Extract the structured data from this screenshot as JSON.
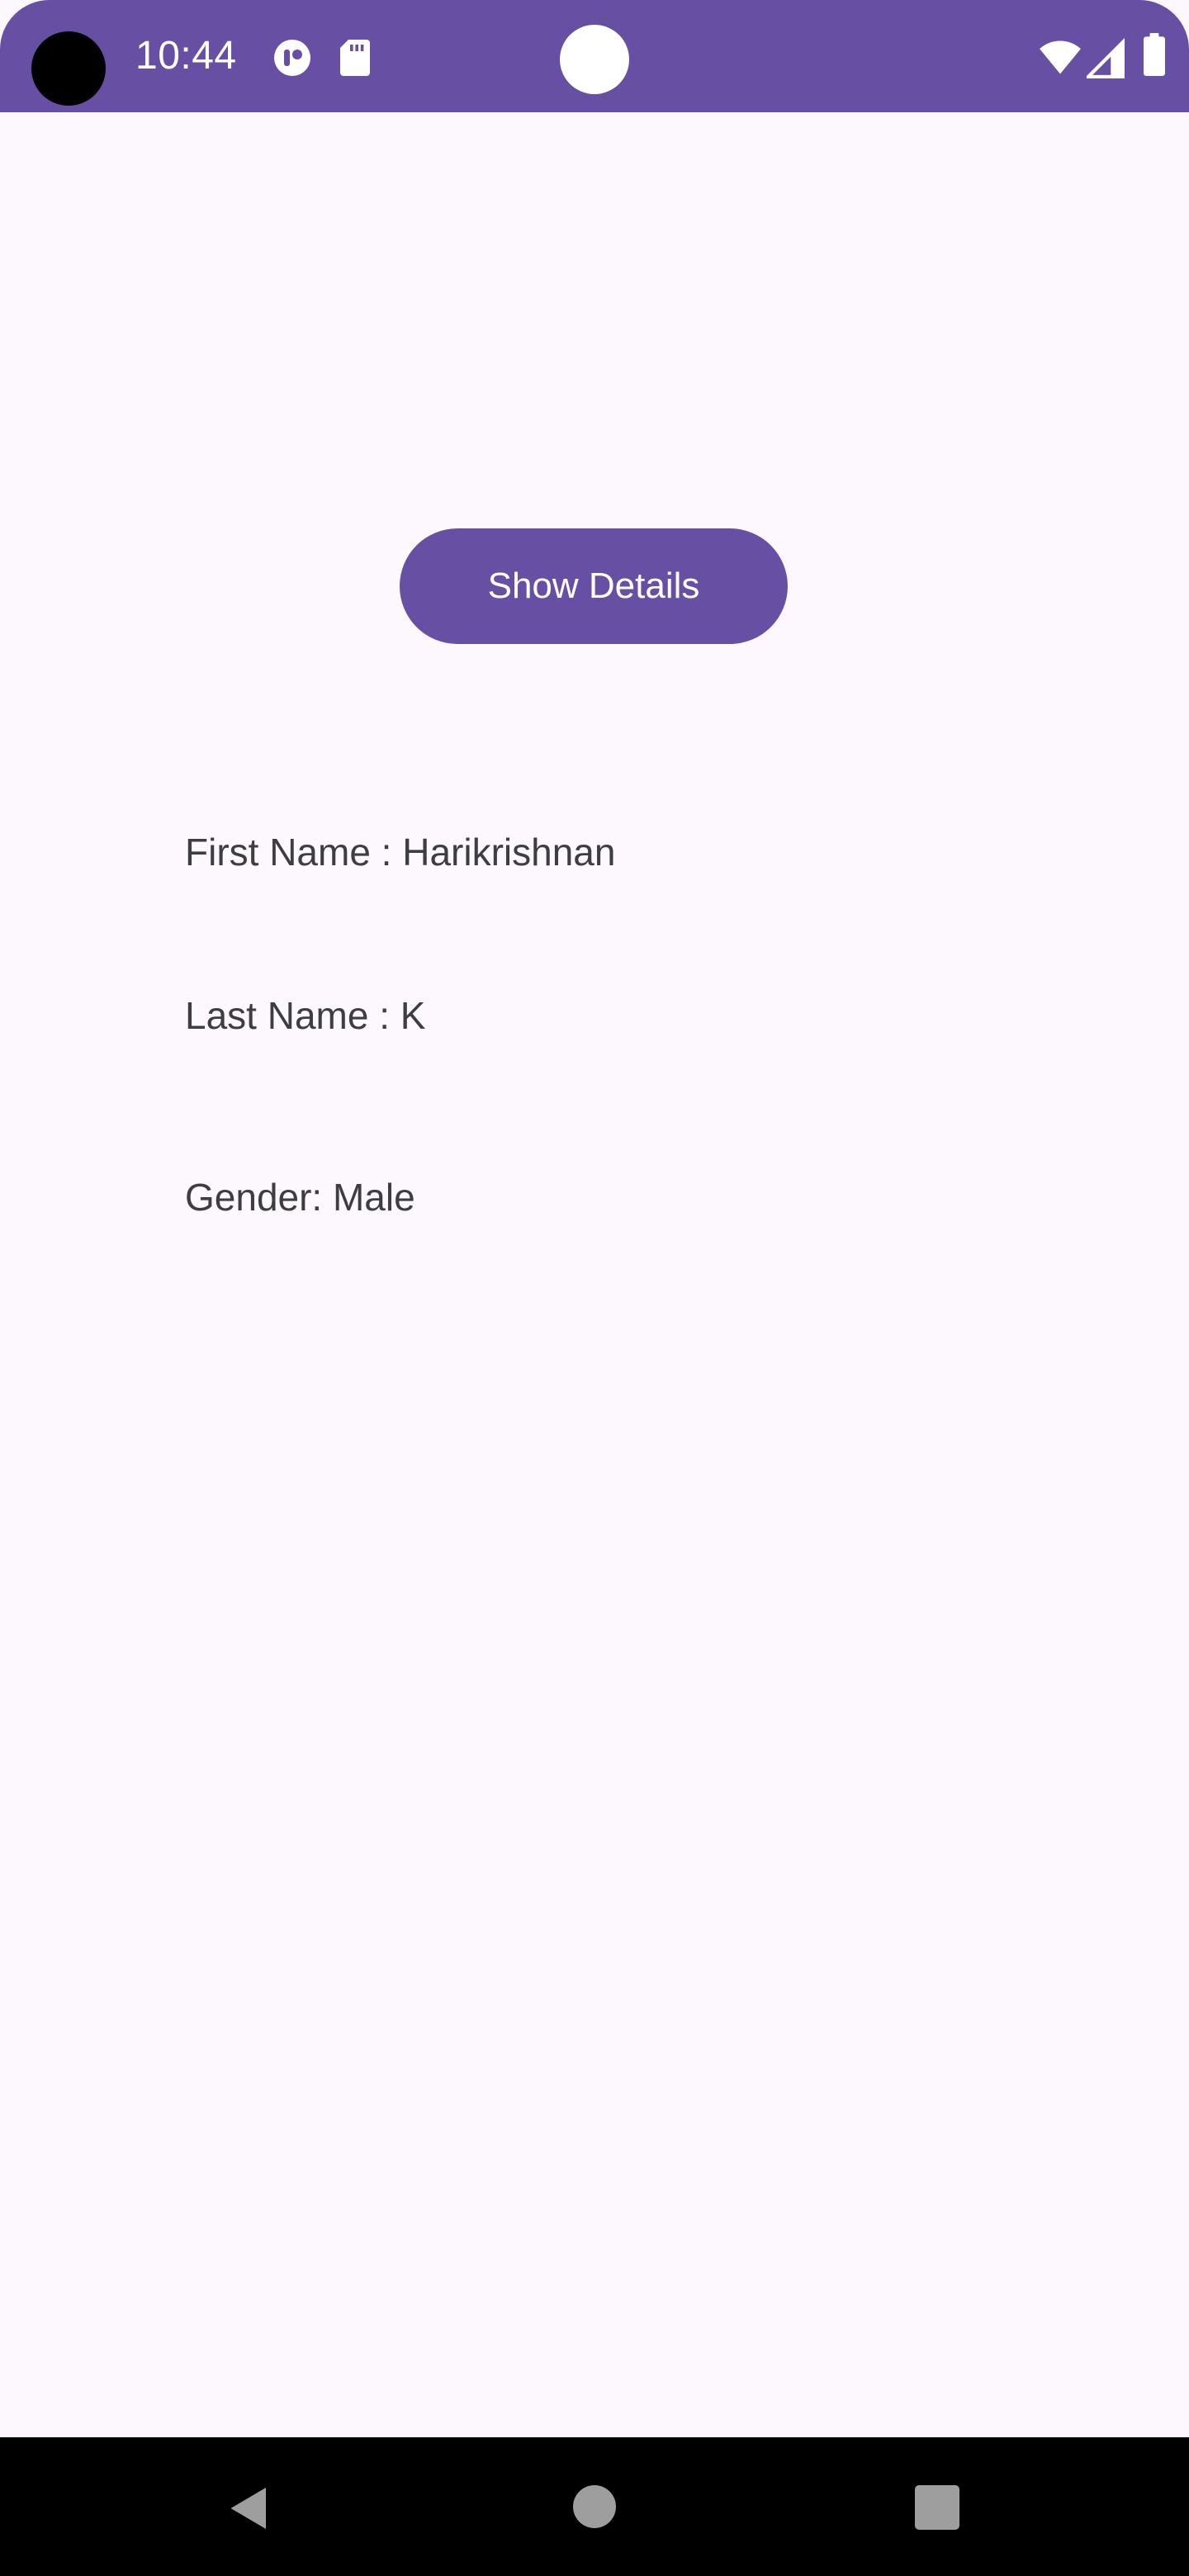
{
  "status_bar": {
    "time": "10:44",
    "color": "#6750A4",
    "icons": [
      "camera-cutout",
      "app-notification-icon",
      "sd-card-icon",
      "center-dot",
      "wifi-icon",
      "cellular-signal-icon",
      "battery-icon"
    ]
  },
  "main": {
    "button_label": "Show Details",
    "first_name_text": "First Name : Harikrishnan",
    "last_name_text": "Last Name : K",
    "gender_text": "Gender: Male",
    "accent_color": "#6750A4",
    "background_color": "#FDF8FD"
  },
  "nav_bar": {
    "icons": [
      "back-icon",
      "home-icon",
      "recents-icon"
    ]
  }
}
